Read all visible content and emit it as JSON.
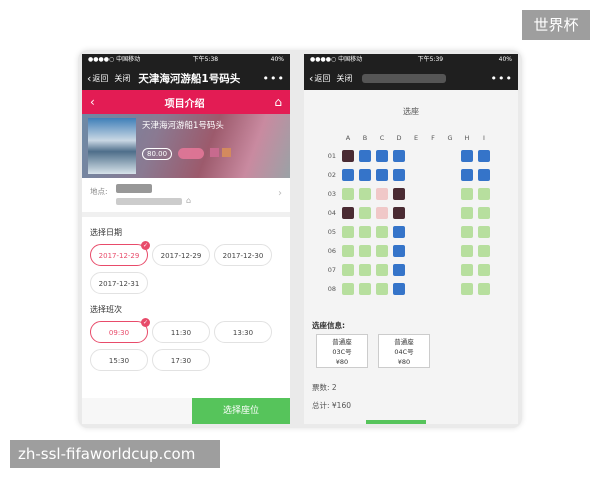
{
  "watermarks": {
    "top_right": "世界杯",
    "bottom_left": "zh-ssl-fifaworldcup.com"
  },
  "left_phone": {
    "status": {
      "carrier": "●●●●○ 中国移动 ",
      "time": "下午5:38",
      "battery": "40%"
    },
    "nav": {
      "back": "返回",
      "close": "关闭",
      "title": "天津海河游船1号码头",
      "more": "•••"
    },
    "header": {
      "title": "项目介绍",
      "back_icon": "chevron-left-icon",
      "home_icon": "home-icon"
    },
    "banner": {
      "name": "天津海河游船1号码头",
      "price": "80.00"
    },
    "address": {
      "label": "地点:"
    },
    "date_section": {
      "title": "选择日期",
      "dates": [
        "2017-12-29",
        "2017-12-29",
        "2017-12-30",
        "2017-12-31"
      ],
      "selected": 0
    },
    "time_section": {
      "title": "选择班次",
      "times": [
        "09:30",
        "11:30",
        "13:30",
        "15:30",
        "17:30"
      ],
      "selected": 0
    },
    "confirm": "选择座位"
  },
  "right_phone": {
    "status": {
      "carrier": "●●●●○ 中国移动 ",
      "time": "下午5:39",
      "battery": "40%"
    },
    "nav": {
      "back": "返回",
      "close": "关闭",
      "more": "•••"
    },
    "seat_title": "选座",
    "columns": [
      "A",
      "B",
      "C",
      "D",
      "E",
      "F",
      "G",
      "H",
      "I"
    ],
    "rows": [
      "01",
      "02",
      "03",
      "04",
      "05",
      "06",
      "07",
      "08"
    ],
    "legend_colors": {
      "sold": "#4a2b33",
      "available_blue": "#3574c9",
      "available_green": "#b7df9e",
      "selected": "#f0c8c8"
    },
    "seats": [
      [
        "sold",
        "available_blue",
        "available_blue",
        "available_blue",
        "",
        "",
        "",
        "available_blue",
        "available_blue"
      ],
      [
        "available_blue",
        "available_blue",
        "available_blue",
        "available_blue",
        "",
        "",
        "",
        "available_blue",
        "available_blue"
      ],
      [
        "available_green",
        "available_green",
        "selected",
        "sold",
        "",
        "",
        "",
        "available_green",
        "available_green"
      ],
      [
        "sold",
        "available_green",
        "selected",
        "sold",
        "",
        "",
        "",
        "available_green",
        "available_green"
      ],
      [
        "available_green",
        "available_green",
        "available_green",
        "available_blue",
        "",
        "",
        "",
        "available_green",
        "available_green"
      ],
      [
        "available_green",
        "available_green",
        "available_green",
        "available_blue",
        "",
        "",
        "",
        "available_green",
        "available_green"
      ],
      [
        "available_green",
        "available_green",
        "available_green",
        "available_blue",
        "",
        "",
        "",
        "available_green",
        "available_green"
      ],
      [
        "available_green",
        "available_green",
        "available_green",
        "available_blue",
        "",
        "",
        "",
        "available_green",
        "available_green"
      ]
    ],
    "info": {
      "title": "选座信息:",
      "tickets": [
        {
          "type": "普通座",
          "seat": "03C号",
          "price": "¥80"
        },
        {
          "type": "普通座",
          "seat": "04C号",
          "price": "¥80"
        }
      ],
      "count": "票数: 2",
      "total": "总计: ¥160"
    }
  }
}
